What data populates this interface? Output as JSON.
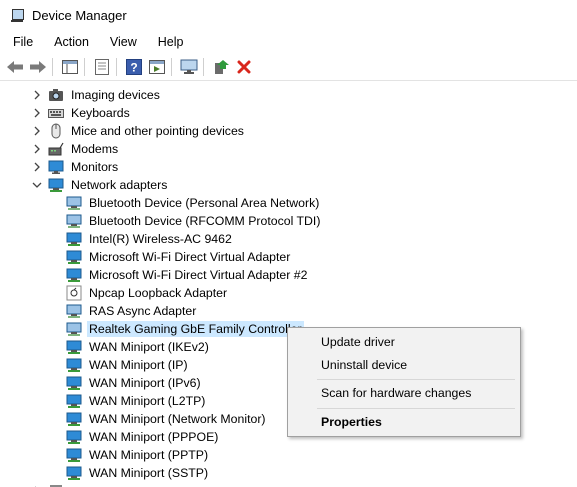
{
  "window": {
    "title": "Device Manager"
  },
  "menu": [
    "File",
    "Action",
    "View",
    "Help"
  ],
  "toolbar_icons": [
    "back-arrow-icon",
    "forward-arrow-icon",
    "show-hide-console-tree-icon",
    "properties-icon",
    "help-icon",
    "run-action-icon",
    "scan-hardware-monitor-icon",
    "update-driver-icon",
    "uninstall-device-icon"
  ],
  "colors": {
    "selection": "#cce8ff",
    "menu_bg": "#f2f2f2",
    "uninstall_red": "#d9261c",
    "update_green": "#2f9a3c",
    "help_blue": "#3a5dad"
  },
  "tree": {
    "categories_before": [
      {
        "label": "Imaging devices",
        "icon": "camera-icon"
      },
      {
        "label": "Keyboards",
        "icon": "keyboard-icon"
      },
      {
        "label": "Mice and other pointing devices",
        "icon": "mouse-icon"
      },
      {
        "label": "Modems",
        "icon": "modem-icon"
      },
      {
        "label": "Monitors",
        "icon": "monitor-icon"
      }
    ],
    "network_adapters": {
      "label": "Network adapters",
      "children": [
        "Bluetooth Device (Personal Area Network)",
        "Bluetooth Device (RFCOMM Protocol TDI)",
        "Intel(R) Wireless-AC 9462",
        "Microsoft Wi-Fi Direct Virtual Adapter",
        "Microsoft Wi-Fi Direct Virtual Adapter #2",
        "Npcap Loopback Adapter",
        "RAS Async Adapter",
        "Realtek Gaming GbE Family Controller",
        "WAN Miniport (IKEv2)",
        "WAN Miniport (IP)",
        "WAN Miniport (IPv6)",
        "WAN Miniport (L2TP)",
        "WAN Miniport (Network Monitor)",
        "WAN Miniport (PPPOE)",
        "WAN Miniport (PPTP)",
        "WAN Miniport (SSTP)"
      ],
      "selected": "Realtek Gaming GbE Family Controller"
    }
  },
  "context_menu": {
    "update_driver": "Update driver",
    "uninstall_device": "Uninstall device",
    "scan": "Scan for hardware changes",
    "properties": "Properties"
  }
}
